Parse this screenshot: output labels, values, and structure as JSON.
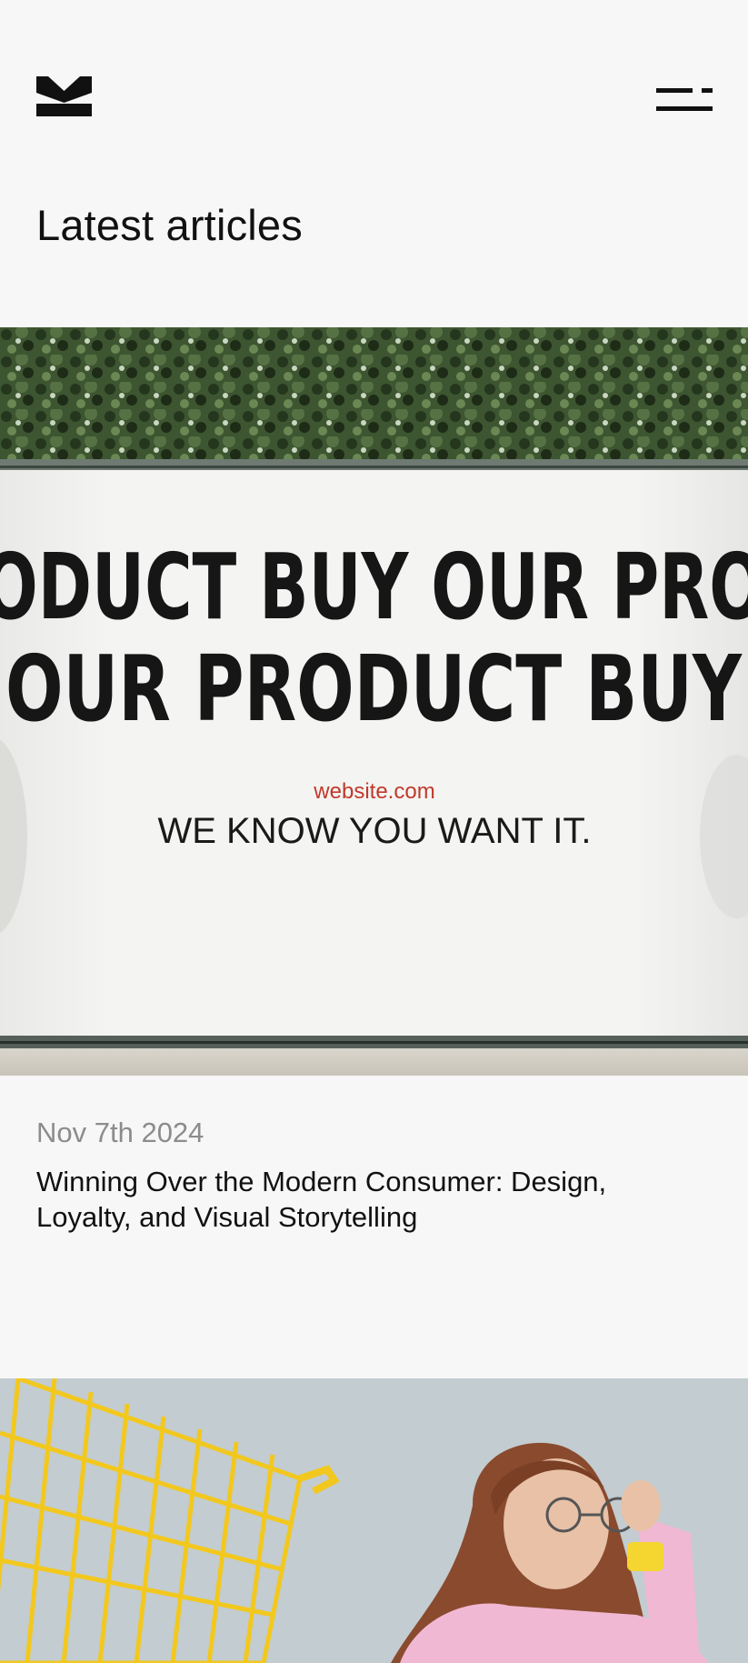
{
  "header": {
    "logo_icon": "brand-mark-icon",
    "menu_icon": "menu-icon"
  },
  "page_title": "Latest articles",
  "articles": [
    {
      "image": {
        "description_icon": "billboard-image",
        "billboard_line_1": "ODUCT  BUY OUR PRO",
        "billboard_line_2": "OUR PRODUCT  BUY",
        "billboard_url": "website.com",
        "billboard_tagline": "WE KNOW YOU WANT IT."
      },
      "date": "Nov 7th 2024",
      "title": "Winning Over the Modern Consumer: Design, Loyalty, and Visual Storytelling"
    },
    {
      "image": {
        "description_icon": "shopping-cart-woman-image"
      }
    }
  ],
  "colors": {
    "background": "#f7f7f7",
    "text": "#111111",
    "date": "#8c8c8c",
    "accent_red": "#c0392b",
    "cart_yellow": "#f2c81e"
  }
}
